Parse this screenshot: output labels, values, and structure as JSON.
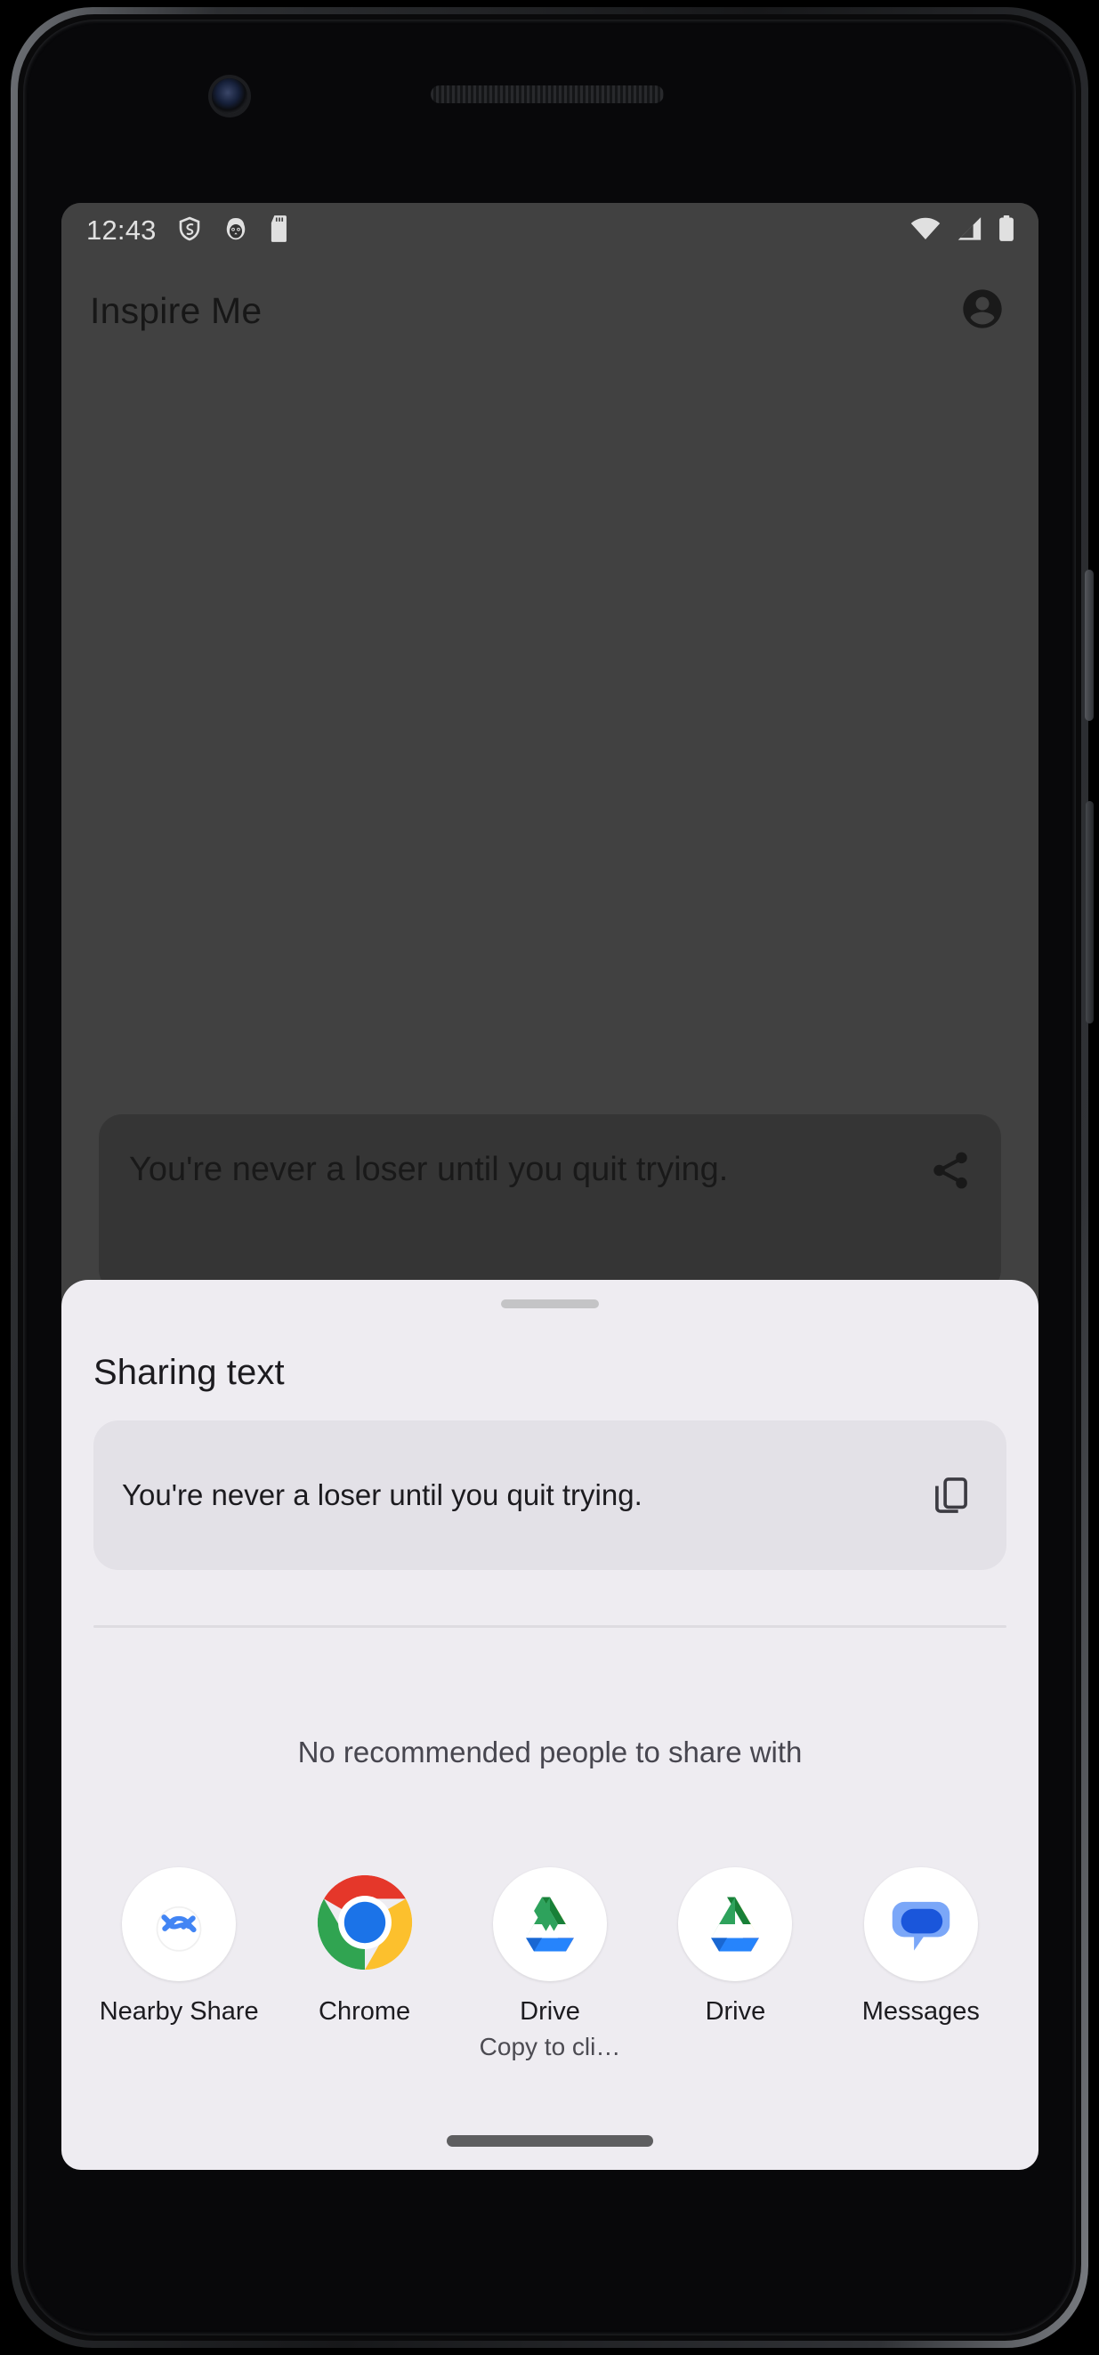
{
  "device": {
    "frame": "pixel-phone",
    "camera_icon": "front-camera-lens",
    "speaker_icon": "earpiece-speaker"
  },
  "statusbar": {
    "clock": "12:43",
    "left_icons": [
      "shield-vpn-icon",
      "owl-app-icon",
      "sd-card-icon"
    ],
    "right_icons": [
      "wifi-icon",
      "cellular-signal-icon",
      "battery-icon"
    ]
  },
  "appbar": {
    "title": "Inspire Me",
    "avatar_icon": "account-circle-icon"
  },
  "background_app": {
    "quote_partial": "You're never a loser until you quit trying.",
    "share_icon": "share-icon",
    "background_color": "#4a4a4a"
  },
  "sheet": {
    "drag_handle": "sheet-drag-handle",
    "title": "Sharing text",
    "preview": {
      "text": "You're never a loser until you quit trying.",
      "copy_icon": "copy-to-clipboard-icon"
    },
    "no_recommendations": "No recommended people to share with",
    "apps": [
      {
        "label": "Nearby Share",
        "sublabel": "",
        "icon": "nearby-share-icon",
        "colors": {
          "accent": "#4285f4"
        }
      },
      {
        "label": "Chrome",
        "sublabel": "",
        "icon": "chrome-icon",
        "colors": {
          "red": "#e5372a",
          "yellow": "#fcc02d",
          "green": "#30a451",
          "blue": "#1b73e8"
        }
      },
      {
        "label": "Drive",
        "sublabel": "Copy to cli…",
        "icon": "google-drive-icon",
        "colors": {
          "blue": "#2684fc",
          "green": "#2ea25c",
          "yellow": "#ffc107",
          "red": "#ea4335",
          "darkgreen": "#188038",
          "darkblue": "#1967d2"
        }
      },
      {
        "label": "Drive",
        "sublabel": "",
        "icon": "google-drive-icon",
        "colors": {
          "blue": "#2684fc",
          "green": "#2ea25c",
          "yellow": "#ffc107",
          "red": "#ea4335",
          "darkgreen": "#188038",
          "darkblue": "#1967d2"
        }
      },
      {
        "label": "Messages",
        "sublabel": "",
        "icon": "google-messages-icon",
        "colors": {
          "light": "#7ba7f8",
          "dark": "#1a56db"
        }
      }
    ],
    "gesture_pill": "navigation-gesture-pill",
    "background_color": "#eeecf1"
  }
}
